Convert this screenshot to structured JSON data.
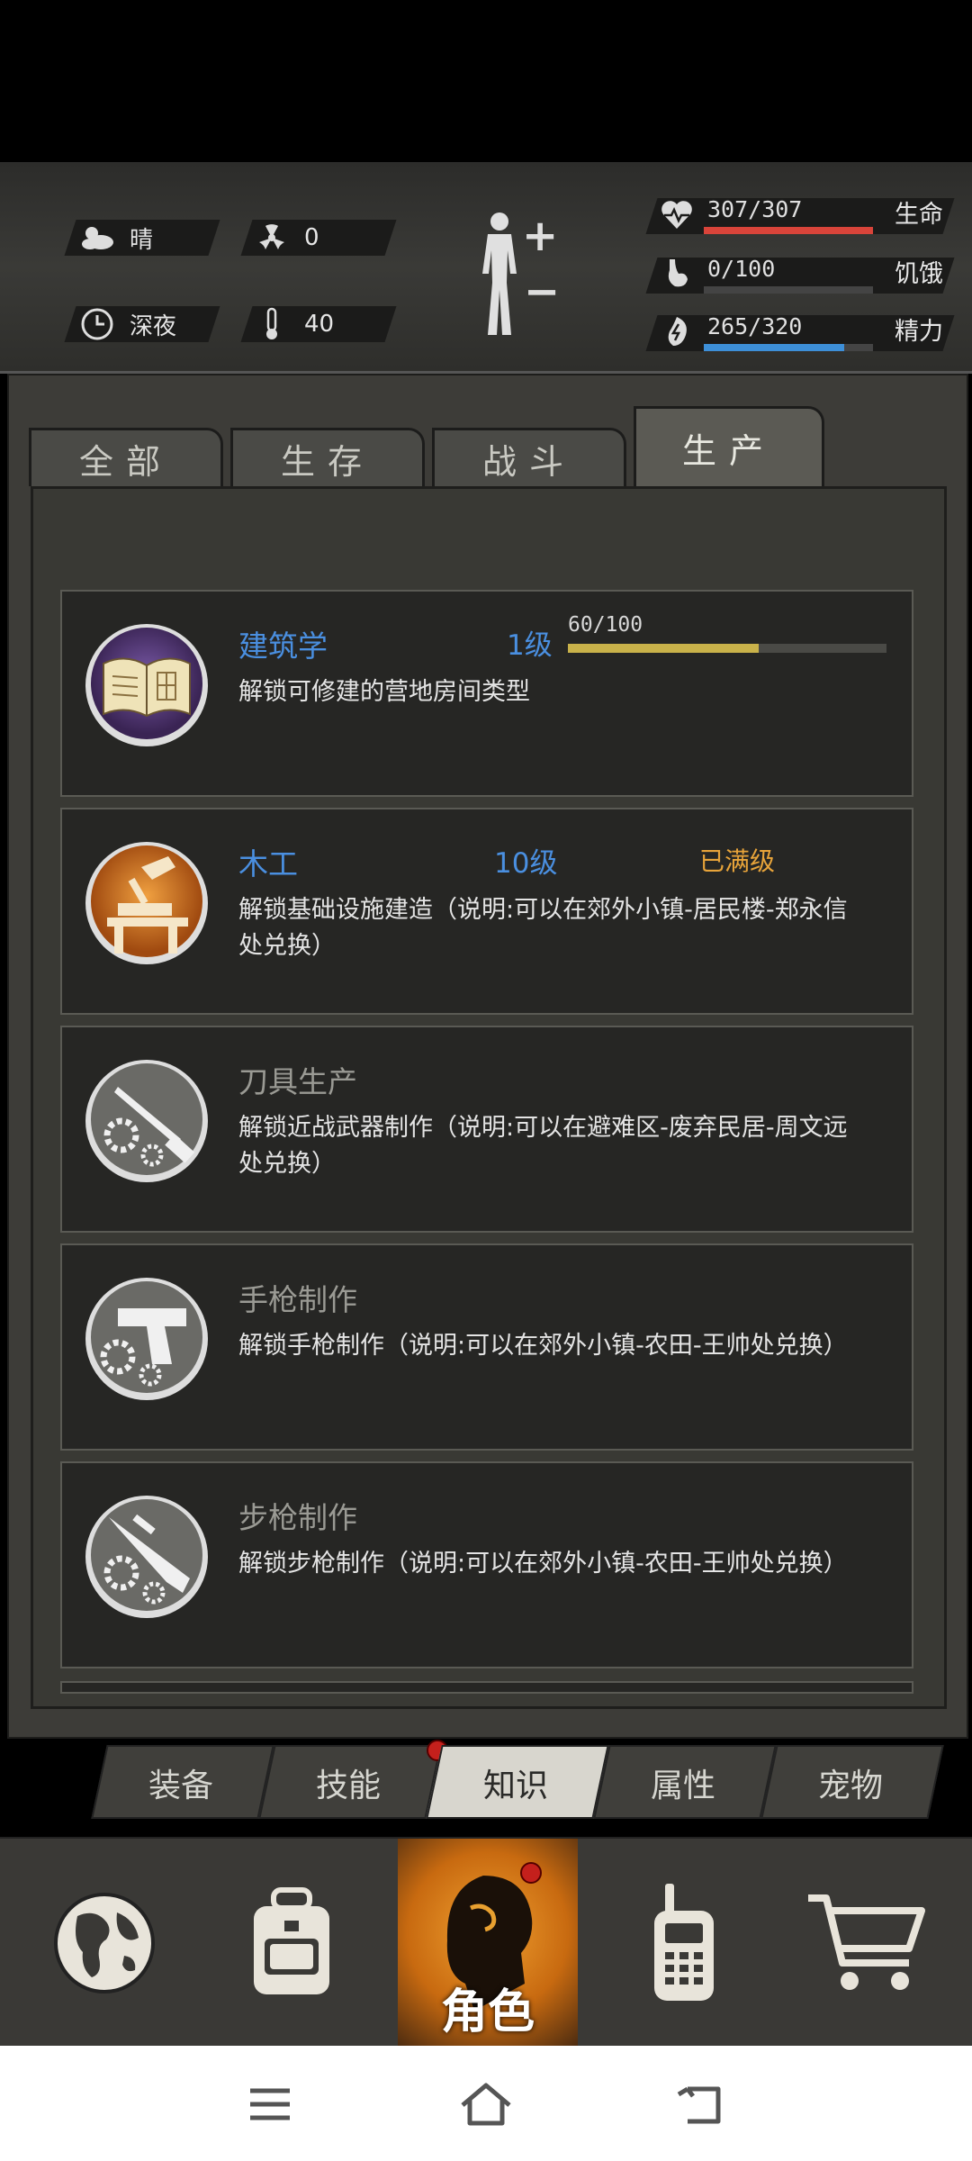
{
  "status": {
    "weather": {
      "label": "晴",
      "icon": "cloud-sun-icon"
    },
    "radiation": {
      "value": "0",
      "icon": "radiation-icon"
    },
    "time": {
      "label": "深夜",
      "icon": "clock-icon"
    },
    "temperature": {
      "value": "40",
      "icon": "thermometer-icon"
    }
  },
  "vitals": [
    {
      "key": "health",
      "text": "307/307",
      "label": "生命",
      "fraction": 1.0,
      "color": "#d9443a",
      "icon": "heart-icon"
    },
    {
      "key": "hunger",
      "text": "0/100",
      "label": "饥饿",
      "fraction": 0.0,
      "color": "#8a8a8a",
      "icon": "stomach-icon"
    },
    {
      "key": "energy",
      "text": "265/320",
      "label": "精力",
      "fraction": 0.828,
      "color": "#3d8fd8",
      "icon": "energy-icon"
    }
  ],
  "category_tabs": [
    {
      "label": "全部",
      "active": false
    },
    {
      "label": "生存",
      "active": false
    },
    {
      "label": "战斗",
      "active": false
    },
    {
      "label": "生产",
      "active": true
    }
  ],
  "skills": [
    {
      "name": "建筑学",
      "level": "1级",
      "desc": "解锁可修建的营地房间类型",
      "progress_text": "60/100",
      "progress": 0.6,
      "maxed_label": "",
      "name_color": "#4a8fe0",
      "icon": "book-icon"
    },
    {
      "name": "木工",
      "level": "10级",
      "desc": "解锁基础设施建造（说明:可以在郊外小镇-居民楼-郑永信处兑换）",
      "progress_text": "",
      "progress": 1.0,
      "maxed_label": "已满级",
      "name_color": "#4a8fe0",
      "icon": "carpentry-icon"
    },
    {
      "name": "刀具生产",
      "level": "",
      "desc": "解锁近战武器制作（说明:可以在避难区-废弃民居-周文远处兑换）",
      "progress_text": "",
      "progress": 0,
      "maxed_label": "",
      "name_color": "#9a9a94",
      "icon": "knife-gear-icon"
    },
    {
      "name": "手枪制作",
      "level": "",
      "desc": "解锁手枪制作（说明:可以在郊外小镇-农田-王帅处兑换）",
      "progress_text": "",
      "progress": 0,
      "maxed_label": "",
      "name_color": "#9a9a94",
      "icon": "pistol-gear-icon"
    },
    {
      "name": "步枪制作",
      "level": "",
      "desc": "解锁步枪制作（说明:可以在郊外小镇-农田-王帅处兑换）",
      "progress_text": "",
      "progress": 0,
      "maxed_label": "",
      "name_color": "#9a9a94",
      "icon": "rifle-gear-icon"
    }
  ],
  "sub_tabs": [
    {
      "label": "装备",
      "active": false,
      "dot": false
    },
    {
      "label": "技能",
      "active": false,
      "dot": true
    },
    {
      "label": "知识",
      "active": true,
      "dot": false
    },
    {
      "label": "属性",
      "active": false,
      "dot": false
    },
    {
      "label": "宠物",
      "active": false,
      "dot": false
    }
  ],
  "bottom_nav": [
    {
      "icon": "globe-icon",
      "label": ""
    },
    {
      "icon": "backpack-icon",
      "label": ""
    },
    {
      "icon": "character-icon",
      "label": "角色",
      "active": true
    },
    {
      "icon": "walkie-talkie-icon",
      "label": ""
    },
    {
      "icon": "cart-icon",
      "label": ""
    }
  ]
}
